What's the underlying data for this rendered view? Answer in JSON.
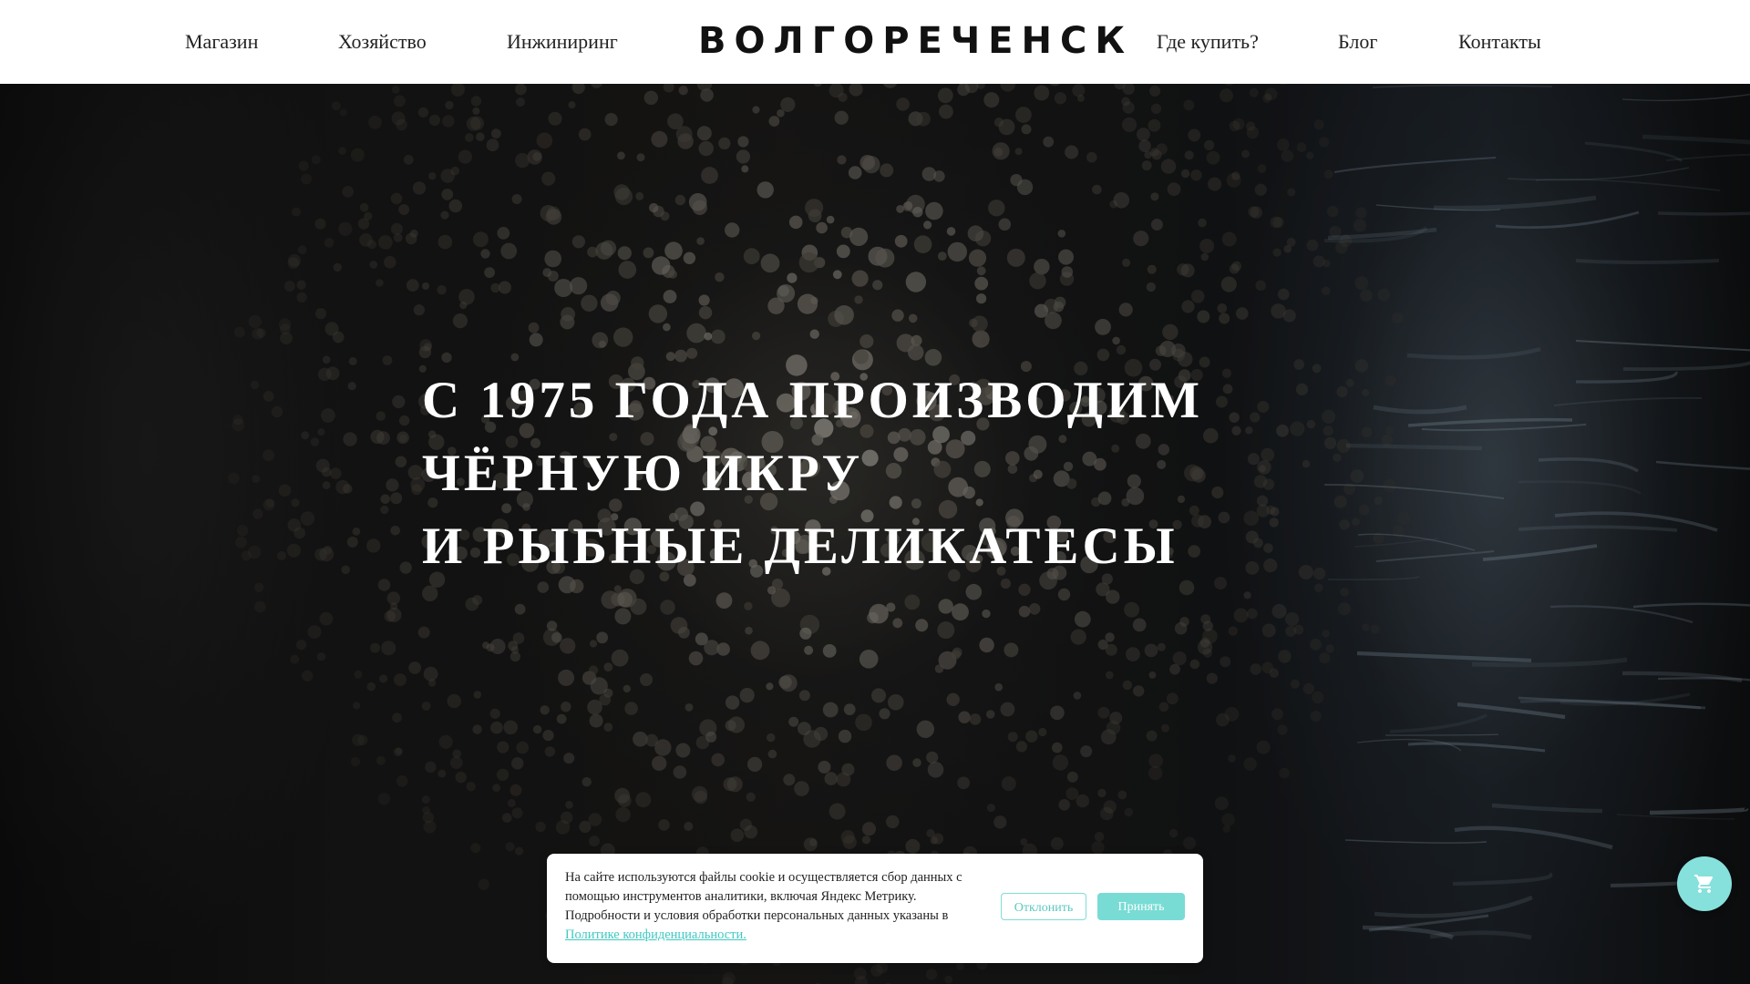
{
  "header": {
    "nav_left": [
      "Магазин",
      "Хозяйство",
      "Инжиниринг"
    ],
    "logo": "ВОЛГОРЕЧЕНСК",
    "nav_right": [
      "Где купить?",
      "Блог",
      "Контакты"
    ]
  },
  "hero": {
    "lines": [
      "С 1975 ГОДА ПРОИЗВОДИМ",
      "ЧЁРНУЮ ИКРУ",
      "И РЫБНЫЕ ДЕЛИКАТЕСЫ"
    ]
  },
  "cookie": {
    "text": "На сайте используются файлы cookie и осуществляется сбор данных с помощью инструментов аналитики, включая Яндекс Метрику. Подробности и условия обработки персональных данных указаны в",
    "link": "Политике конфиденциальности.",
    "decline": "Отклонить",
    "accept": "Принять"
  },
  "cart": {
    "icon": "cart-icon"
  },
  "colors": {
    "accent": "#78dcd4",
    "header_bg": "#ffffff",
    "hero_text": "#ffffff"
  }
}
